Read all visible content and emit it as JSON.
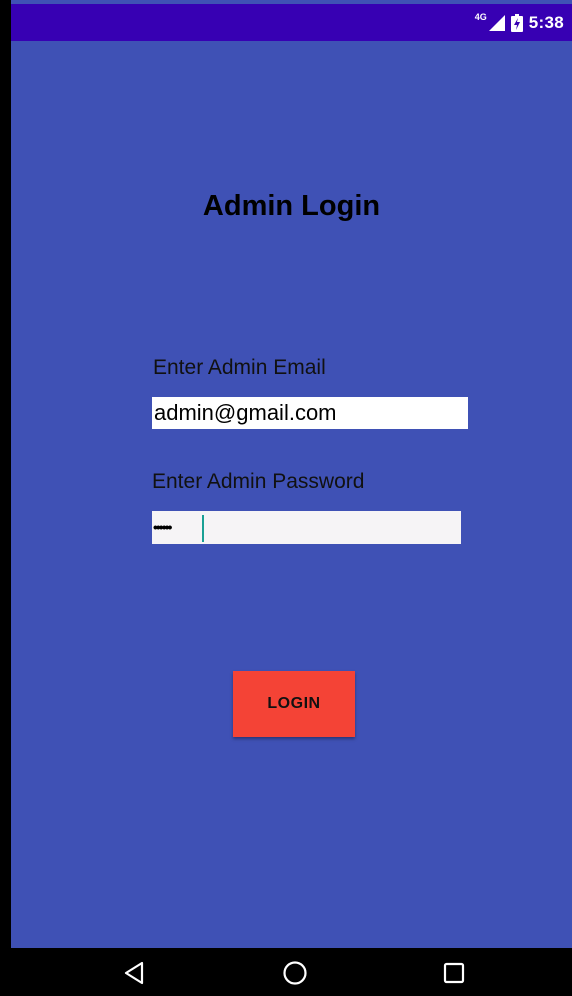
{
  "status_bar": {
    "network_type": "4G",
    "signal_icon": "cell-signal-icon",
    "battery_icon": "battery-charging-icon",
    "time": "5:38"
  },
  "login": {
    "title": "Admin Login",
    "email_label": "Enter Admin Email",
    "email_value": "admin@gmail.com",
    "password_label": "Enter Admin Password",
    "password_masked": "••••••",
    "button_label": "LOGIN"
  },
  "nav_bar": {
    "back_icon": "back-triangle-icon",
    "home_icon": "home-circle-icon",
    "recents_icon": "recents-square-icon"
  },
  "colors": {
    "background": "#3f51b5",
    "status_bar": "#3700b3",
    "button": "#f44336",
    "caret": "#1aa095"
  }
}
